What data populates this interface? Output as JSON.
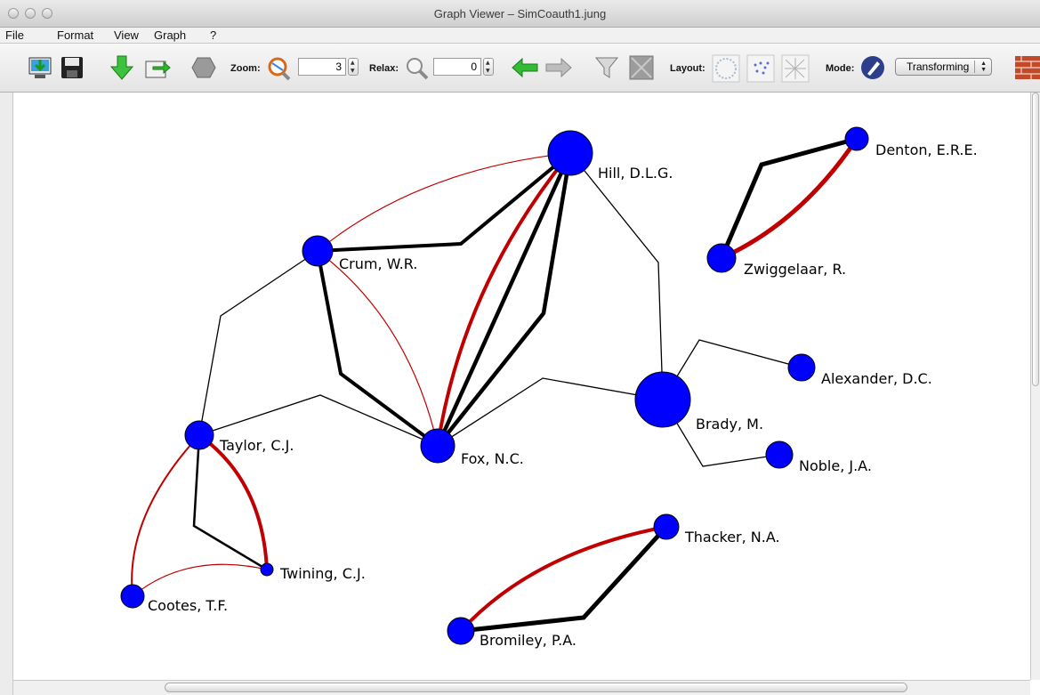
{
  "window": {
    "title": "Graph Viewer – SimCoauth1.jung"
  },
  "menu": [
    "File",
    "Format",
    "View",
    "Graph",
    "?"
  ],
  "toolbar": {
    "zoom_label": "Zoom:",
    "zoom_value": "3",
    "relax_label": "Relax:",
    "relax_value": "0",
    "layout_label": "Layout:",
    "mode_label": "Mode:",
    "mode_value": "Transforming",
    "icons": [
      "import-icon",
      "save-icon",
      "download-icon",
      "export-icon",
      "hexagon-icon",
      "zoom-icon",
      "relax-magnifier-icon",
      "undo-arrow-icon",
      "redo-arrow-icon",
      "filter-funnel-icon",
      "clear-icon",
      "circle-layout-icon",
      "scatter-layout-icon",
      "spring-layout-icon",
      "mode-pen-icon",
      "brick-wall-icon"
    ]
  },
  "graph": {
    "colors": {
      "node": "#0000ff",
      "edge_black": "#000000",
      "edge_red": "#c00000"
    },
    "nodes": [
      {
        "id": "hill",
        "label": "Hill, D.L.G."
      },
      {
        "id": "crum",
        "label": "Crum, W.R."
      },
      {
        "id": "fox",
        "label": "Fox, N.C."
      },
      {
        "id": "taylor",
        "label": "Taylor, C.J."
      },
      {
        "id": "twining",
        "label": "Twining, C.J."
      },
      {
        "id": "cootes",
        "label": "Cootes, T.F."
      },
      {
        "id": "brady",
        "label": "Brady, M."
      },
      {
        "id": "alexander",
        "label": "Alexander, D.C."
      },
      {
        "id": "noble",
        "label": "Noble, J.A."
      },
      {
        "id": "denton",
        "label": "Denton, E.R.E."
      },
      {
        "id": "zwiggelaar",
        "label": "Zwiggelaar, R."
      },
      {
        "id": "thacker",
        "label": "Thacker, N.A."
      },
      {
        "id": "bromiley",
        "label": "Bromiley, P.A."
      }
    ]
  }
}
